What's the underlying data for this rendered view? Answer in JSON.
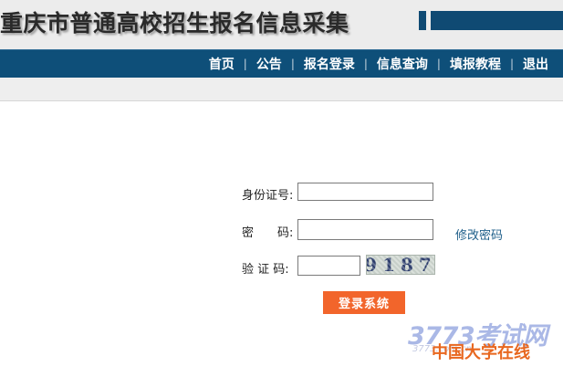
{
  "header": {
    "title": "重庆市普通高校招生报名信息采集"
  },
  "nav": {
    "items": [
      "首页",
      "公告",
      "报名登录",
      "信息查询",
      "填报教程",
      "退出"
    ]
  },
  "form": {
    "id_label": "身份证号:",
    "id_value": "",
    "password_label": "密　　码:",
    "password_value": "",
    "change_password": "修改密码",
    "captcha_label": "验 证 码:",
    "captcha_value": "",
    "captcha_image_text": "9187",
    "submit_label": "登录系统"
  },
  "watermark": {
    "site": "3773考试网",
    "domain": "3773.com.cn",
    "org": "中国大学在线"
  },
  "colors": {
    "nav_bg": "#0e4f79",
    "submit_bg": "#f2652b",
    "link": "#1f5f8a"
  }
}
